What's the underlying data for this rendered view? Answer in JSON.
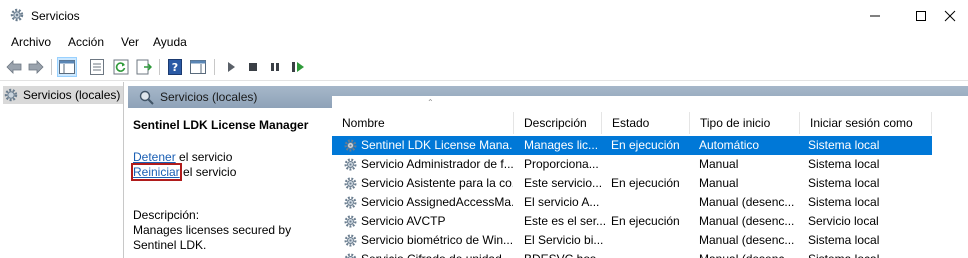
{
  "window": {
    "title": "Servicios"
  },
  "menu": [
    "Archivo",
    "Acción",
    "Ver",
    "Ayuda"
  ],
  "tree": {
    "item_label": "Servicios (locales)"
  },
  "pane": {
    "header_label": "Servicios (locales)",
    "service_title": "Sentinel LDK License Manager",
    "stop_link": "Detener",
    "stop_suffix": " el servicio",
    "restart_link": "Reiniciar",
    "restart_suffix": " el servicio",
    "description_label": "Descripción:",
    "description_text": "Manages licenses secured by Sentinel LDK."
  },
  "table": {
    "columns": [
      "Nombre",
      "Descripción",
      "Estado",
      "Tipo de inicio",
      "Iniciar sesión como"
    ],
    "rows": [
      {
        "name": "Sentinel LDK License Mana...",
        "desc": "Manages lic...",
        "state": "En ejecución",
        "startup": "Automático",
        "logon": "Sistema local",
        "selected": true
      },
      {
        "name": "Servicio Administrador de f...",
        "desc": "Proporciona...",
        "state": "",
        "startup": "Manual",
        "logon": "Sistema local",
        "selected": false
      },
      {
        "name": "Servicio Asistente para la co...",
        "desc": "Este servicio...",
        "state": "En ejecución",
        "startup": "Manual",
        "logon": "Sistema local",
        "selected": false
      },
      {
        "name": "Servicio AssignedAccessMa...",
        "desc": "El servicio A...",
        "state": "",
        "startup": "Manual (desenc...",
        "logon": "Sistema local",
        "selected": false
      },
      {
        "name": "Servicio AVCTP",
        "desc": "Este es el ser...",
        "state": "En ejecución",
        "startup": "Manual (desenc...",
        "logon": "Servicio local",
        "selected": false
      },
      {
        "name": "Servicio biométrico de Win...",
        "desc": "El Servicio bi...",
        "state": "",
        "startup": "Manual (desenc...",
        "logon": "Sistema local",
        "selected": false
      },
      {
        "name": "Servicio Cifrado de unidad...",
        "desc": "BDESVC hos...",
        "state": "",
        "startup": "Manual (desenc...",
        "logon": "Sistema local",
        "selected": false
      }
    ]
  },
  "colors": {
    "selection": "#0078d7",
    "link": "#1a5fb4",
    "header_gradient_top": "#a6b7c9",
    "focus_outline": "#b01c1c"
  }
}
